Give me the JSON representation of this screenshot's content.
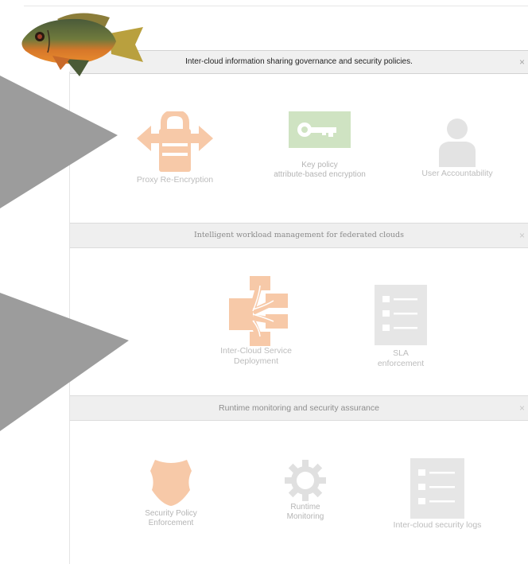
{
  "panels": [
    {
      "title": "Inter-cloud information sharing governance and security policies.",
      "close": "×",
      "items": [
        {
          "label": "Proxy Re-Encryption",
          "icon": "padlock-arrows-icon"
        },
        {
          "label_line1": "Key policy",
          "label_line2": "attribute-based encryption",
          "icon": "key-icon"
        },
        {
          "label": "User Accountability",
          "icon": "user-icon"
        }
      ]
    },
    {
      "title": "Intelligent workload management for federated clouds",
      "close": "×",
      "items": [
        {
          "label_line1": "Inter-Cloud Service",
          "label_line2": "Deployment",
          "icon": "network-distribution-icon"
        },
        {
          "label_line1": "SLA",
          "label_line2": "enforcement",
          "icon": "checklist-icon"
        }
      ]
    },
    {
      "title": "Runtime monitoring and security  assurance",
      "close": "×",
      "items": [
        {
          "label_line1": "Security Policy",
          "label_line2": "Enforcement",
          "icon": "shield-icon"
        },
        {
          "label_line1": "Runtime",
          "label_line2": "Monitoring",
          "icon": "gear-icon"
        },
        {
          "label": "Inter-cloud security  logs",
          "icon": "list-document-icon"
        }
      ]
    }
  ],
  "colors": {
    "accent_orange": "#f7c9a8",
    "key_green": "#cfe3c2",
    "icon_gray": "#e3e3e3",
    "arrow_gray": "#999999"
  }
}
